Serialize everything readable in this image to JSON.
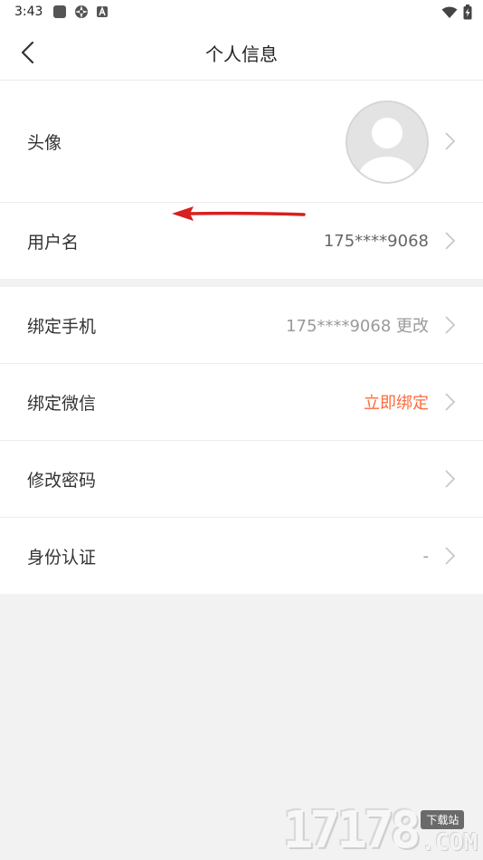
{
  "status_bar": {
    "time": "3:43",
    "icons": [
      "stop-square-icon",
      "aperture-icon",
      "a-badge-icon"
    ],
    "right_icons": [
      "wifi-icon",
      "battery-charging-icon"
    ]
  },
  "header": {
    "title": "个人信息",
    "back_icon": "chevron-left-icon"
  },
  "section1": {
    "avatar_row": {
      "label": "头像",
      "avatar_icon": "default-avatar-icon"
    },
    "username_row": {
      "label": "用户名",
      "value": "175****9068"
    }
  },
  "section2": {
    "phone_row": {
      "label": "绑定手机",
      "value": "175****9068 更改"
    },
    "wechat_row": {
      "label": "绑定微信",
      "value": "立即绑定"
    },
    "password_row": {
      "label": "修改密码"
    },
    "identity_row": {
      "label": "身份认证",
      "value": "-"
    }
  },
  "colors": {
    "accent": "#ff6a3d",
    "annotation_arrow": "#d81f1f"
  },
  "watermark": {
    "number": "17178",
    "badge": "下载站",
    "suffix": ".COM"
  }
}
